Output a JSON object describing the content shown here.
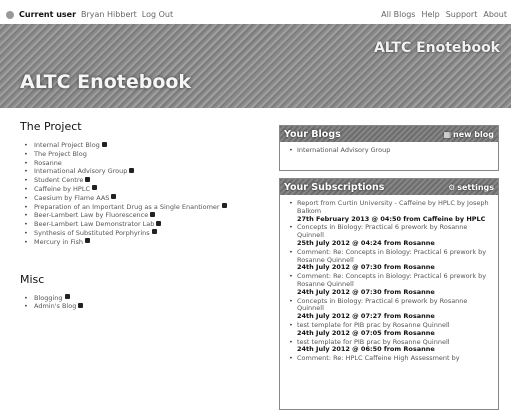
{
  "topbar": {
    "current_user_label": "Current user",
    "user_name": "Bryan Hibbert",
    "logout": "Log Out",
    "links": [
      "All Blogs",
      "Help",
      "Support",
      "About"
    ]
  },
  "banner": {
    "small_title": "ALTC Enotebook",
    "big_title": "ALTC Enotebook"
  },
  "project": {
    "heading": "The Project",
    "items": [
      {
        "label": "Internal Project Blog",
        "locked": true
      },
      {
        "label": "The Project Blog",
        "locked": false
      },
      {
        "label": "Rosanne",
        "locked": false
      },
      {
        "label": "International Advisory Group",
        "locked": true
      },
      {
        "label": "Student Centre",
        "locked": true
      },
      {
        "label": "Caffeine by HPLC",
        "locked": true
      },
      {
        "label": "Caesium by Flame AAS",
        "locked": true
      },
      {
        "label": "Preparation of an Important Drug as a Single Enantiomer",
        "locked": true
      },
      {
        "label": "Beer-Lambert Law by Fluorescence",
        "locked": true
      },
      {
        "label": "Beer-Lambert Law Demonstrator Lab",
        "locked": true
      },
      {
        "label": "Synthesis of Substituted Porphyrins",
        "locked": true
      },
      {
        "label": "Mercury in Fish",
        "locked": true
      }
    ]
  },
  "misc": {
    "heading": "Misc",
    "items": [
      {
        "label": "Blogging",
        "locked": true
      },
      {
        "label": "Admin's Blog",
        "locked": true
      }
    ]
  },
  "your_blogs": {
    "title": "Your Blogs",
    "action": "new blog",
    "items": [
      "International Advisory Group"
    ]
  },
  "your_subscriptions": {
    "title": "Your Subscriptions",
    "action": "settings",
    "items": [
      {
        "text": "Report from Curtin University - Caffeine by HPLC by Joseph Balkom",
        "meta": "27th February 2013 @ 04:50 from Caffeine by HPLC"
      },
      {
        "text": "Concepts in Biology: Practical 6 prework by Rosanne Quinnell",
        "meta": "25th July 2012 @ 04:24 from Rosanne"
      },
      {
        "text": "Comment: Re: Concepts in Biology: Practical 6 prework by Rosanne Quinnell",
        "meta": "24th July 2012 @ 07:30 from Rosanne"
      },
      {
        "text": "Comment: Re: Concepts in Biology: Practical 6 prework by Rosanne Quinnell",
        "meta": "24th July 2012 @ 07:30 from Rosanne"
      },
      {
        "text": "Concepts in Biology: Practical 6 prework by Rosanne Quinnell",
        "meta": "24th July 2012 @ 07:27 from Rosanne"
      },
      {
        "text": "test template for PIB prac by Rosanne Quinnell",
        "meta": "24th July 2012 @ 07:05 from Rosanne"
      },
      {
        "text": "test template for PIB prac by Rosanne Quinnell",
        "meta": "24th July 2012 @ 06:50 from Rosanne"
      },
      {
        "text": "Comment: Re: HPLC Caffeine High Assessment by",
        "meta": ""
      }
    ]
  }
}
